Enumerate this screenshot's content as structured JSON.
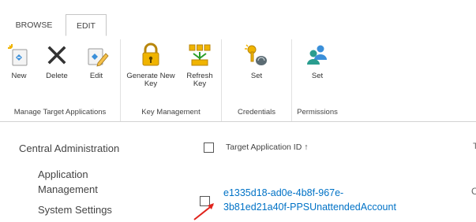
{
  "tabs": {
    "browse": "BROWSE",
    "edit": "EDIT"
  },
  "ribbon": {
    "groups": {
      "manage": "Manage Target Applications",
      "key": "Key Management",
      "credentials": "Credentials",
      "permissions": "Permissions"
    },
    "buttons": {
      "new": "New",
      "delete": "Delete",
      "edit": "Edit",
      "generate": "Generate New\nKey",
      "refresh": "Refresh\nKey",
      "set_credentials": "Set",
      "set_permissions": "Set"
    }
  },
  "nav": {
    "central": "Central Administration",
    "appmgmt": "Application\nManagement",
    "system": "System Settings"
  },
  "list": {
    "header": "Target Application ID",
    "sort_arrow": "↑",
    "row_id": "e1335d18-ad0e-4b8f-967e-\n3b81ed21a40f-PPSUnattendedAccount",
    "cut_header": "T",
    "cut_cell": "C"
  },
  "colors": {
    "link": "#0072c6",
    "arrow": "#e0231c"
  }
}
